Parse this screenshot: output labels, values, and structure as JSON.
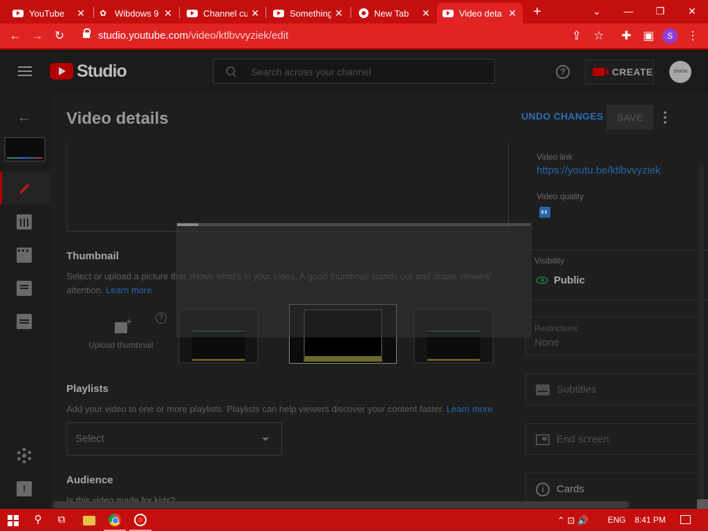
{
  "browser": {
    "tabs": [
      {
        "title": "YouTube",
        "icon": "youtube-favicon"
      },
      {
        "title": "Wibdows 9",
        "icon": "site-favicon"
      },
      {
        "title": "Channel cu",
        "icon": "youtube-favicon"
      },
      {
        "title": "Something",
        "icon": "youtube-favicon"
      },
      {
        "title": "New Tab",
        "icon": "chrome-favicon"
      },
      {
        "title": "Video deta",
        "icon": "youtube-favicon",
        "active": true
      }
    ],
    "close_glyph": "✕",
    "new_tab_glyph": "+",
    "window_controls": {
      "dropdown": "⌄",
      "minimize": "—",
      "restore": "❐",
      "close": "✕"
    },
    "nav": {
      "back": "←",
      "forward": "→",
      "reload": "↻"
    },
    "url": {
      "host": "studio.youtube.com",
      "path": "/video/ktlbvvyziek/edit"
    },
    "toolbar_icons": {
      "share": "⇪",
      "bookmark": "☆",
      "extensions": "✚",
      "sidepanel": "▣",
      "menu": "⋮"
    },
    "profile_initial": "S"
  },
  "studio": {
    "logo_text": "Studio",
    "search_placeholder": "Search across your channel",
    "help_glyph": "?",
    "create_label": "CREATE",
    "avatar_text": "SIMON"
  },
  "rail": {
    "back_glyph": "←",
    "feedback_glyph": "!"
  },
  "page": {
    "title": "Video details",
    "undo_label": "UNDO CHANGES",
    "save_label": "SAVE"
  },
  "thumbnail": {
    "title": "Thumbnail",
    "desc_line1": "Select or upload a picture that shows what's in your video. A good thumbnail stands out and draws viewers'",
    "desc_line2_prefix": "attention.",
    "learn_more": "Learn more",
    "upload_label": "Upload thumbnail",
    "help_glyph": "?"
  },
  "playlists": {
    "title": "Playlists",
    "desc": "Add your video to one or more playlists. Playlists can help viewers discover your content faster.",
    "learn_more": "Learn more",
    "select_label": "Select"
  },
  "audience": {
    "title": "Audience",
    "question": "Is this video made for kids?"
  },
  "right": {
    "video_link_label": "Video link",
    "video_link": "https://youtu.be/ktlbvvyziek",
    "video_quality_label": "Video quality",
    "visibility_label": "Visibility",
    "visibility_value": "Public",
    "restrictions_label": "Restrictions",
    "restrictions_value": "None",
    "subtitles_label": "Subtitles",
    "end_screen_label": "End screen",
    "cards_label": "Cards",
    "cards_glyph": "i"
  },
  "overlay": {
    "progress": 0.06
  },
  "taskbar": {
    "lang": "ENG",
    "time": "8:41 PM",
    "tray_icons": "⌃  ⊡  🔊"
  },
  "colors": {
    "brand_red": "#c50f0f",
    "link_blue": "#2466a8",
    "public_green": "#1f6b3b"
  }
}
